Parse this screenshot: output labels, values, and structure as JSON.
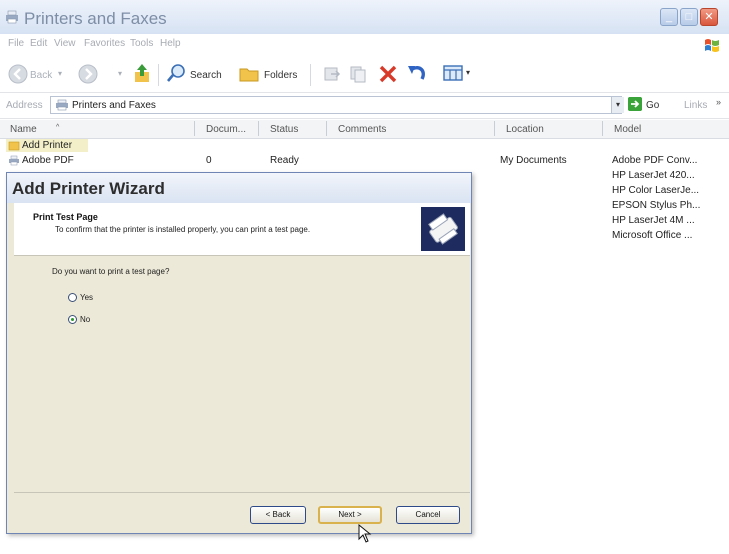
{
  "window": {
    "title": "Printers and Faxes"
  },
  "menu": [
    "File",
    "Edit",
    "View",
    "Favorites",
    "Tools",
    "Help"
  ],
  "toolbar": {
    "back_label": "Back",
    "search_label": "Search",
    "folders_label": "Folders"
  },
  "address": {
    "label": "Address",
    "value": "Printers and Faxes",
    "go_label": "Go",
    "links_label": "Links"
  },
  "columns": [
    "Name",
    "Docum...",
    "Status",
    "Comments",
    "Location",
    "Model"
  ],
  "rows": [
    {
      "name": "Add Printer",
      "documents": "",
      "status": "",
      "location": "",
      "model": ""
    },
    {
      "name": "Adobe PDF",
      "documents": "0",
      "status": "Ready",
      "location": "My Documents",
      "model": "Adobe PDF Conv..."
    }
  ],
  "models": [
    "HP LaserJet 420...",
    "HP Color LaserJe...",
    "EPSON Stylus Ph...",
    "HP LaserJet 4M ...",
    "Microsoft Office ..."
  ],
  "wizard": {
    "title": "Add Printer Wizard",
    "header_title": "Print Test Page",
    "header_desc": "To confirm that the printer is installed properly, you can print a test page.",
    "question": "Do you want to print a test page?",
    "option_yes": "Yes",
    "option_no": "No",
    "selected": "No",
    "back_button": "< Back",
    "next_button": "Next >",
    "cancel_button": "Cancel"
  }
}
